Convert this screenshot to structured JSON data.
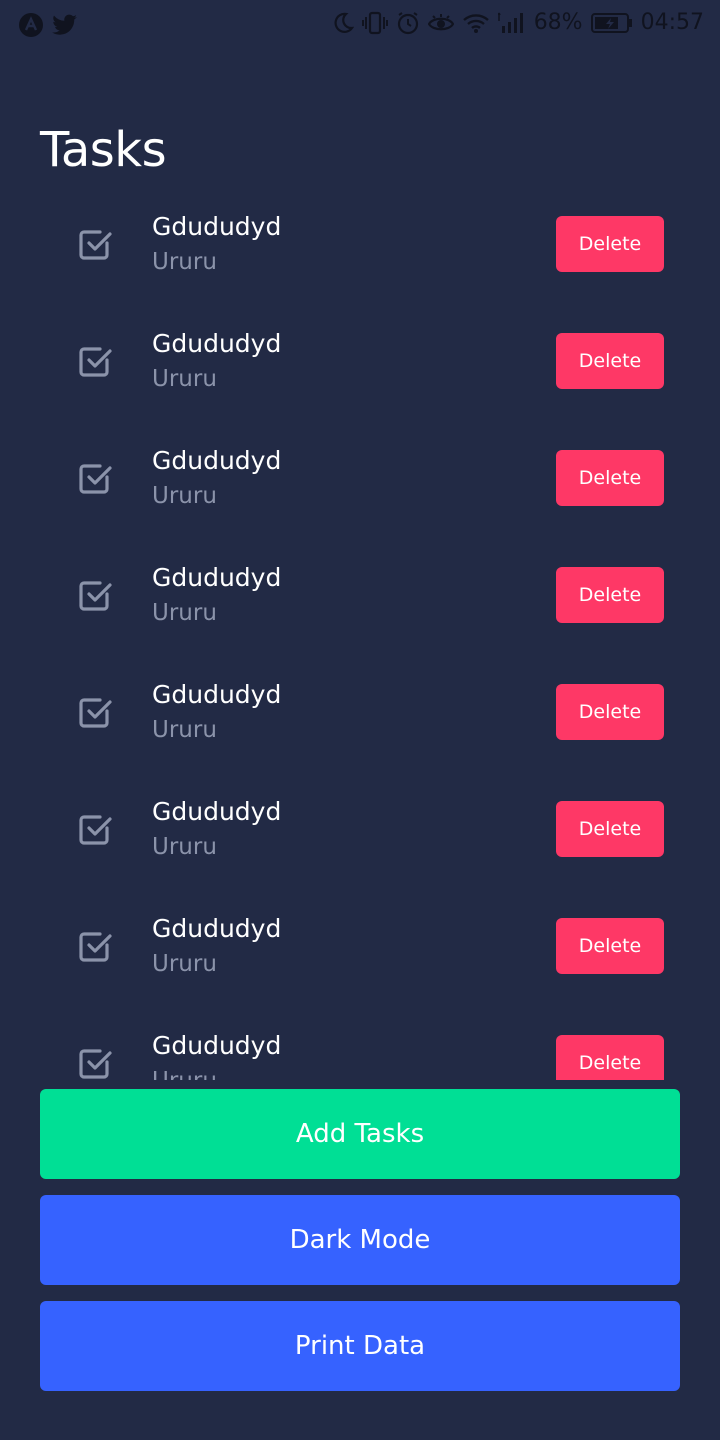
{
  "colors": {
    "background": "#222a45",
    "delete": "#fe3866",
    "add": "#00df95",
    "primary": "#3662ff",
    "subtext": "#8b93aa"
  },
  "status_bar": {
    "left_icons": [
      "app-icon",
      "twitter-icon"
    ],
    "right_icons": [
      "moon-icon",
      "vibrate-icon",
      "alarm-icon",
      "eye-icon",
      "wifi-icon",
      "signal-icon",
      "battery-icon"
    ],
    "battery": "68%",
    "time": "04:57"
  },
  "page": {
    "title": "Tasks"
  },
  "tasks": [
    {
      "title": "Gdududyd",
      "subtitle": "Ururu",
      "delete_label": "Delete",
      "checked": true
    },
    {
      "title": "Gdududyd",
      "subtitle": "Ururu",
      "delete_label": "Delete",
      "checked": true
    },
    {
      "title": "Gdududyd",
      "subtitle": "Ururu",
      "delete_label": "Delete",
      "checked": true
    },
    {
      "title": "Gdududyd",
      "subtitle": "Ururu",
      "delete_label": "Delete",
      "checked": true
    },
    {
      "title": "Gdududyd",
      "subtitle": "Ururu",
      "delete_label": "Delete",
      "checked": true
    },
    {
      "title": "Gdududyd",
      "subtitle": "Ururu",
      "delete_label": "Delete",
      "checked": true
    },
    {
      "title": "Gdududyd",
      "subtitle": "Ururu",
      "delete_label": "Delete",
      "checked": true
    },
    {
      "title": "Gdududyd",
      "subtitle": "Ururu",
      "delete_label": "Delete",
      "checked": true
    }
  ],
  "actions": {
    "add_label": "Add Tasks",
    "dark_mode_label": "Dark Mode",
    "print_label": "Print Data"
  }
}
